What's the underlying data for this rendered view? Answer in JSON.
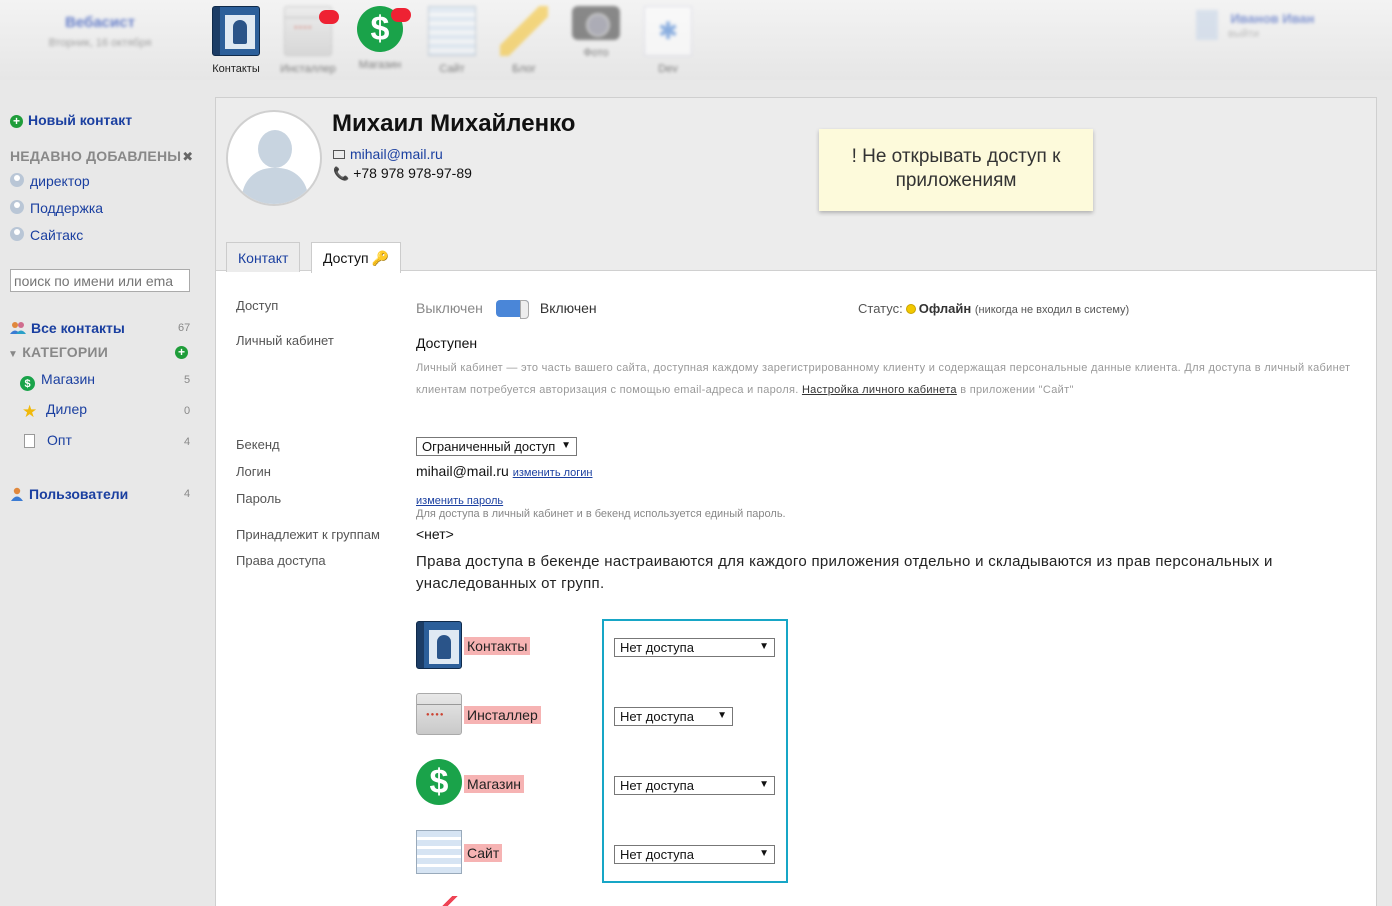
{
  "topbar": {
    "brand_name": "Вебасист",
    "brand_date": "Вторник, 16 октября",
    "apps": [
      {
        "label": "Контакты",
        "icon": "contacts-icon"
      },
      {
        "label": "Инсталлер",
        "icon": "installer-icon"
      },
      {
        "label": "Магазин",
        "icon": "shop-icon"
      },
      {
        "label": "Сайт",
        "icon": "site-icon"
      },
      {
        "label": "Блог",
        "icon": "blog-icon"
      },
      {
        "label": "Фото",
        "icon": "photo-icon"
      },
      {
        "label": "Dev",
        "icon": "developer-icon"
      }
    ],
    "user_name": "Иванов Иван",
    "user_sub": "выйти"
  },
  "sidebar": {
    "new_contact": "Новый контакт",
    "recent_title": "НЕДАВНО ДОБАВЛЕНЫ",
    "recent": [
      "директор",
      "Поддержка",
      "Сайтакс"
    ],
    "search_placeholder": "поиск по имени или ema",
    "all_contacts": "Все контакты",
    "all_contacts_count": "67",
    "categories_title": "КАТЕГОРИИ",
    "categories": [
      {
        "label": "Магазин",
        "count": "5",
        "icon": "shop-icon"
      },
      {
        "label": "Дилер",
        "count": "0",
        "icon": "star-icon"
      },
      {
        "label": "Опт",
        "count": "4",
        "icon": "page-icon"
      }
    ],
    "users": "Пользователи",
    "users_count": "4"
  },
  "contact": {
    "name": "Михаил Михайленко",
    "email": "mihail@mail.ru",
    "phone": "+78 978 978-97-89",
    "note": "! Не открывать доступ к приложениям"
  },
  "tabs": {
    "contact": "Контакт",
    "access": "Доступ"
  },
  "access": {
    "access_label": "Доступ",
    "off": "Выключен",
    "on": "Включен",
    "toggle_state": "on",
    "status_label": "Статус:",
    "status_value": "Офлайн",
    "status_note": "(никогда не входил в систему)",
    "cabinet_label": "Личный кабинет",
    "cabinet_value": "Доступен",
    "cabinet_desc": "Личный кабинет — это часть вашего сайта, доступная каждому зарегистрированному клиенту и содержащая персональные данные клиента. Для доступа в личный кабинет клиентам потребуется авторизация с помощью email-адреса и пароля.",
    "cabinet_link": "Настройка личного кабинета",
    "cabinet_desc_tail": "в приложении \"Сайт\"",
    "backend_label": "Бекенд",
    "backend_value": "Ограниченный доступ",
    "login_label": "Логин",
    "login_value": "mihail@mail.ru",
    "login_change": "изменить логин",
    "password_label": "Пароль",
    "password_change": "изменить пароль",
    "password_hint": "Для доступа в личный кабинет и в бекенд используется единый пароль.",
    "groups_label": "Принадлежит к группам",
    "groups_value": "<нет>",
    "rights_label": "Права доступа",
    "rights_text": "Права доступа в бекенде настраиваются для каждого приложения отдельно и складываются из прав персональных и унаследованных от групп.",
    "apps": [
      {
        "name": "Контакты",
        "value": "Нет доступа",
        "icon": "contacts-icon"
      },
      {
        "name": "Инсталлер",
        "value": "Нет доступа",
        "icon": "installer-icon"
      },
      {
        "name": "Магазин",
        "value": "Нет доступа",
        "icon": "shop-icon"
      },
      {
        "name": "Сайт",
        "value": "Нет доступа",
        "icon": "site-icon"
      }
    ]
  }
}
